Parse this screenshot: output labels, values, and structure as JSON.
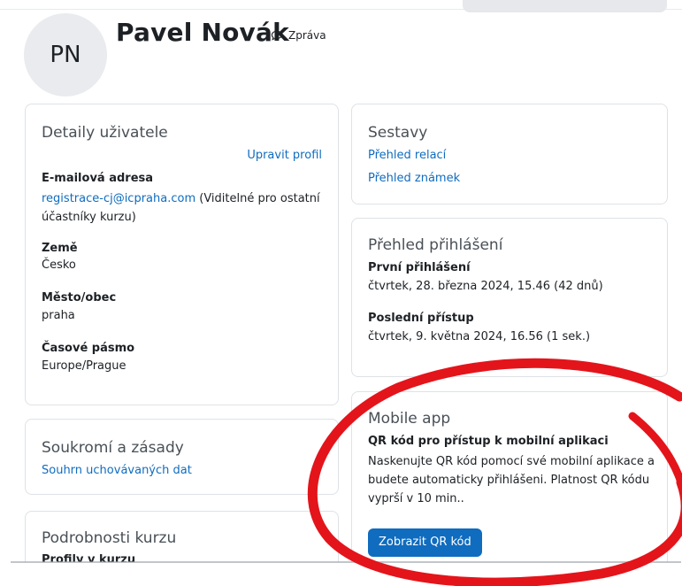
{
  "profile": {
    "initials": "PN",
    "name": "Pavel Novák",
    "message_label": "Zpráva"
  },
  "user_details": {
    "title": "Detaily uživatele",
    "edit_link": "Upravit profil",
    "email_label": "E-mailová adresa",
    "email_value": "registrace-cj@icpraha.com",
    "email_note_1": " (Viditelné pro ostatní",
    "email_note_2": "účastníky kurzu)",
    "country_label": "Země",
    "country_value": "Česko",
    "city_label": "Město/obec",
    "city_value": "praha",
    "timezone_label": "Časové pásmo",
    "timezone_value": "Europe/Prague"
  },
  "privacy": {
    "title": "Soukromí a zásady",
    "link": "Souhrn uchovávaných dat"
  },
  "course": {
    "title": "Podrobnosti kurzu",
    "partial_label": "Profily v kurzu"
  },
  "reports": {
    "title": "Sestavy",
    "links": [
      "Přehled relací",
      "Přehled známek"
    ]
  },
  "login": {
    "title": "Přehled přihlášení",
    "first_label": "První přihlášení",
    "first_value": "čtvrtek, 28. března 2024, 15.46  (42 dnů)",
    "last_label": "Poslední přístup",
    "last_value": "čtvrtek, 9. května 2024, 16.56  (1 sek.)"
  },
  "mobile": {
    "title": "Mobile app",
    "heading": "QR kód pro přístup k mobilní aplikaci",
    "text_1": "Naskenujte QR kód pomocí své mobilní aplikace a",
    "text_2": "budete automaticky přihlášeni. Platnost QR kódu",
    "text_3": "vyprší v 10 min..",
    "button": "Zobrazit QR kód"
  },
  "colors": {
    "link": "#0f6cbf",
    "primary": "#0f6cbf",
    "annotation": "#e4141b"
  },
  "icons": {
    "message": "speech-bubble-icon"
  }
}
